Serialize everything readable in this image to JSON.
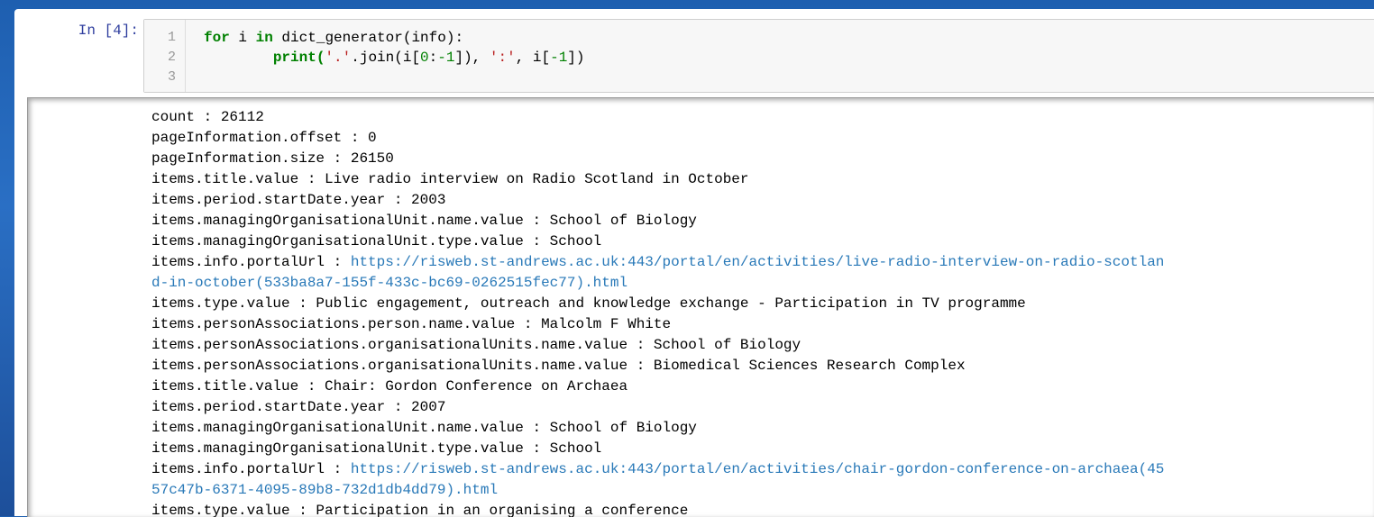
{
  "cell": {
    "prompt": "In [4]:",
    "line_numbers": [
      "1",
      "2",
      "3"
    ],
    "code": {
      "line1": {
        "kw_for": "for",
        "var": " i ",
        "kw_in": "in",
        "rest": " dict_generator(info):"
      },
      "line2": {
        "indent": "        print(",
        "str1": "'.'",
        "mid1": ".join(i[",
        "num0": "0",
        "colon": ":",
        "neg": "-1",
        "mid2": "]), ",
        "str2": "':'",
        "mid3": ", i[",
        "neg2": "-1",
        "end": "])"
      }
    }
  },
  "output": {
    "lines": [
      {
        "text": "count : 26112"
      },
      {
        "text": "pageInformation.offset : 0"
      },
      {
        "text": "pageInformation.size : 26150"
      },
      {
        "text": "items.title.value : Live radio interview on Radio Scotland in October"
      },
      {
        "text": "items.period.startDate.year : 2003"
      },
      {
        "text": "items.managingOrganisationalUnit.name.value : School of Biology"
      },
      {
        "text": "items.managingOrganisationalUnit.type.value : School"
      },
      {
        "text": "items.info.portalUrl : ",
        "link": "https://risweb.st-andrews.ac.uk:443/portal/en/activities/live-radio-interview-on-radio-scotlan"
      },
      {
        "text": "",
        "link": "d-in-october(533ba8a7-155f-433c-bc69-0262515fec77).html"
      },
      {
        "text": "items.type.value : Public engagement, outreach and knowledge exchange - Participation in TV programme"
      },
      {
        "text": "items.personAssociations.person.name.value : Malcolm F White"
      },
      {
        "text": "items.personAssociations.organisationalUnits.name.value : School of Biology"
      },
      {
        "text": "items.personAssociations.organisationalUnits.name.value : Biomedical Sciences Research Complex"
      },
      {
        "text": "items.title.value : Chair: Gordon Conference on Archaea"
      },
      {
        "text": "items.period.startDate.year : 2007"
      },
      {
        "text": "items.managingOrganisationalUnit.name.value : School of Biology"
      },
      {
        "text": "items.managingOrganisationalUnit.type.value : School"
      },
      {
        "text": "items.info.portalUrl : ",
        "link": "https://risweb.st-andrews.ac.uk:443/portal/en/activities/chair-gordon-conference-on-archaea(45"
      },
      {
        "text": "",
        "link": "57c47b-6371-4095-89b8-732d1db4dd79).html"
      },
      {
        "text": "items.type.value : Participation in an organising a conference"
      }
    ]
  },
  "colors": {
    "prompt": "#303f9f",
    "keyword": "#008000",
    "string": "#ba2121",
    "link": "#2979b8"
  }
}
